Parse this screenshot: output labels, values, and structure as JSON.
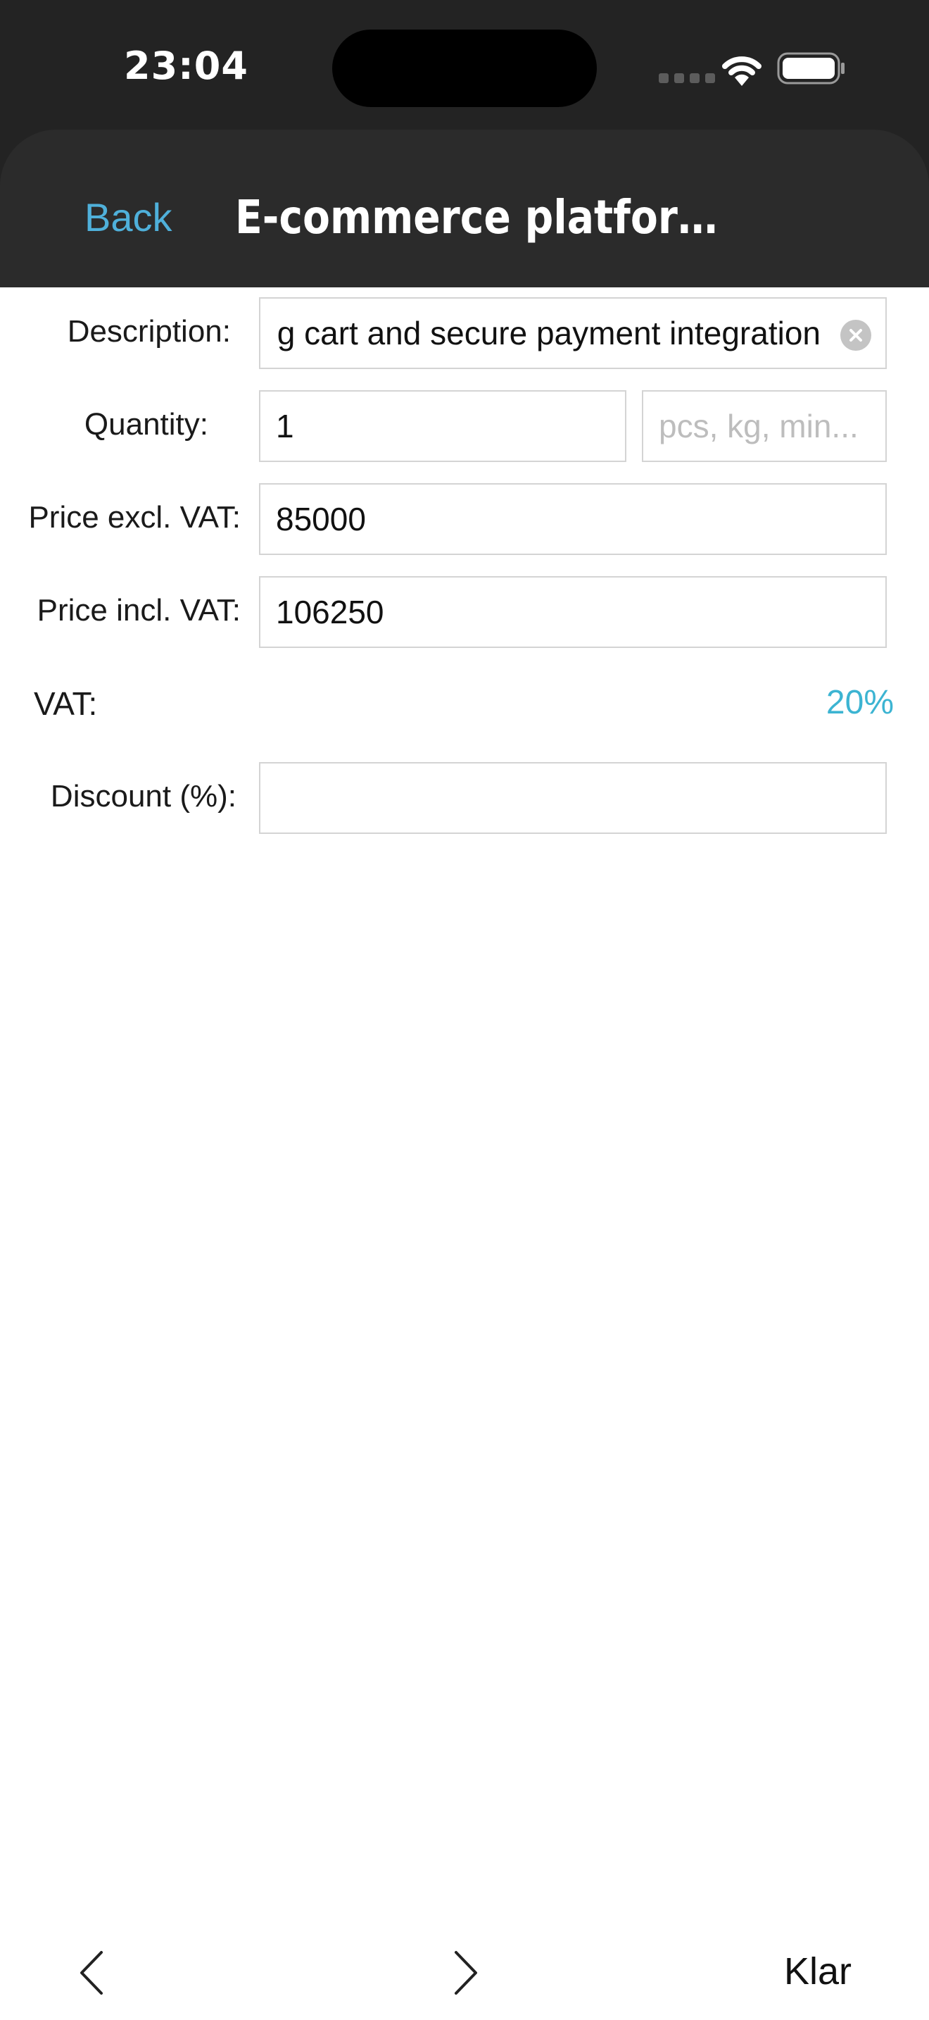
{
  "status_bar": {
    "time": "23:04",
    "icons": [
      "signal-dots-icon",
      "wifi-icon",
      "battery-icon"
    ]
  },
  "nav": {
    "back_label": "Back",
    "title": "E-commerce platform develop..."
  },
  "form": {
    "description": {
      "label": "Description:",
      "value": "g cart and secure payment integration"
    },
    "quantity": {
      "label": "Quantity:",
      "value": "1",
      "unit_placeholder": "pcs, kg, min..."
    },
    "price_excl": {
      "label": "Price excl. VAT:",
      "value": "85000"
    },
    "price_incl": {
      "label": "Price incl. VAT:",
      "value": "106250"
    },
    "vat": {
      "label": "VAT:",
      "value": "20%"
    },
    "discount": {
      "label": "Discount (%):",
      "value": ""
    }
  },
  "toolbar": {
    "done_label": "Klar"
  },
  "colors": {
    "accent": "#4fb0da",
    "vat_value": "#3cb4d2",
    "header_bg": "#232323",
    "sheet_bg": "#2b2b2b",
    "field_border": "#d4d4d4"
  }
}
